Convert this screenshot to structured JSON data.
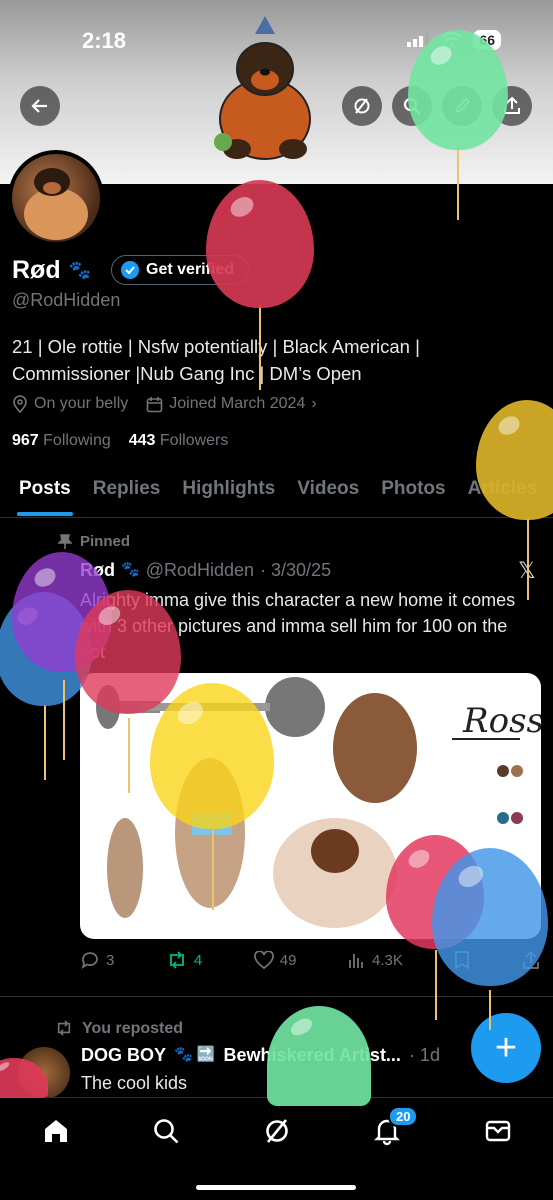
{
  "status_bar": {
    "time": "2:18",
    "battery": "66"
  },
  "profile": {
    "display_name": "Rød",
    "name_emoji": "🐾",
    "verify_label": "Get verified",
    "handle": "@RodHidden",
    "bio_line1": "21 | Ole rottie | Nsfw potentially | Black American |",
    "bio_line2": "Commissioner |Nub Gang Inc | DM’s Open",
    "location": "On your belly",
    "joined": "Joined March 2024",
    "following_count": "967",
    "following_label": "Following",
    "followers_count": "443",
    "followers_label": "Followers"
  },
  "tabs": [
    "Posts",
    "Replies",
    "Highlights",
    "Videos",
    "Photos",
    "Articles"
  ],
  "pinned_post": {
    "pinned_label": "Pinned",
    "name": "Rød",
    "name_emoji": "🐾",
    "handle": "@RodHidden",
    "date": "· 3/30/25",
    "text": "Alrighty imma give this character a new home it comes with 3 other pictures and imma sell him for 100 on the dot",
    "media_signature": "Ross",
    "replies": "3",
    "reposts": "4",
    "likes": "49",
    "views": "4.3K"
  },
  "second_post": {
    "repost_label": "You reposted",
    "name": "DOG BOY",
    "name_extra": "🐾 🔜",
    "cont": "Bewhiskered Artist...",
    "time": "· 1d",
    "text": "The cool kids"
  },
  "nav": {
    "notifications_badge": "20"
  },
  "colors": {
    "accent": "#1d9bf0",
    "repost_green": "#00ba7c",
    "muted": "#71767b"
  }
}
